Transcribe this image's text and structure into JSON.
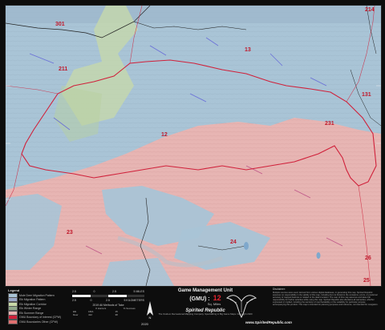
{
  "map": {
    "gmu_labels": [
      {
        "id": "gmu-301",
        "text": "301"
      },
      {
        "id": "gmu-211",
        "text": "211"
      },
      {
        "id": "gmu-13",
        "text": "13"
      },
      {
        "id": "gmu-131",
        "text": "131"
      },
      {
        "id": "gmu-12",
        "text": "12"
      },
      {
        "id": "gmu-231",
        "text": "231"
      },
      {
        "id": "gmu-23",
        "text": "23"
      },
      {
        "id": "gmu-24",
        "text": "24"
      },
      {
        "id": "gmu-26",
        "text": "26"
      },
      {
        "id": "gmu-25",
        "text": "25"
      },
      {
        "id": "gmu-214",
        "text": "214"
      }
    ],
    "colors": {
      "water_blue": "#a9c4d6",
      "elk_pink": "#e7b5b3",
      "green_corridor": "#c8d9a8",
      "boundary_red": "#d0203a",
      "road_black": "#222222"
    }
  },
  "legend": {
    "title": "Legend",
    "items": [
      {
        "label": "Mule Deer Migration Pattern",
        "color": "#a9c4d6"
      },
      {
        "label": "Elk Migration Pattern",
        "color": "#9aa8c9"
      },
      {
        "label": "Elk Migration Corridor",
        "color": "#c8d9a8"
      },
      {
        "label": "Elk Winter Range",
        "color": "#8fa88a"
      },
      {
        "label": "Elk Summer Range",
        "color": "#e7b5b3"
      },
      {
        "label": "GMU Boundary of Interest (CPW)",
        "color": "#d0203a"
      },
      {
        "label": "GMU Boundaries Other (CPW)",
        "color": "#e07070"
      }
    ]
  },
  "scale": {
    "labels_top": [
      "2.5",
      "0",
      "2.5",
      "5 MILES"
    ],
    "labels_bottom": [
      "2.5",
      "0",
      "2.5",
      "5 KILOMETERS"
    ]
  },
  "stats": {
    "title": "2019 All Methods of Take",
    "headers": [
      "",
      "# Hunters",
      "% Success"
    ],
    "rows": [
      {
        "species": "Elk",
        "hunters": "1821",
        "success": "15"
      },
      {
        "species": "Deer",
        "hunters": "412",
        "success": "38"
      }
    ]
  },
  "title_block": {
    "title": "Game Management Unit",
    "gmu_prefix": "(GMU) :",
    "gmu_value": "12",
    "sq_miles": "Sq. Miles",
    "brand": "Spirited Republic",
    "brand_sub": "The Outdoor Recreational Mapping Company. Specializing in Big Game Maps. Copyright 2020",
    "year": "2020",
    "url": "www.SpiritedRepublic.com"
  },
  "disclaimer": {
    "title": "Disclaimer:",
    "body": "Multiple sources were used, derived from various digital databases, in generating this map. Spirited Republic assumes no responsibility in the validity of this map, including but not limited to the omissions, errors, or positional accuracy of mapped features or related to the data's location. The user of this map assumes and takes full responsibility for his/her activities while using this map. Spirited Republic also disclaims all warranties, whether expressed or implied, including the warranty of merchantability or the suitability for particular purpose accompanying this product. This map is intended for planning purposes and reference, not intended for navigation."
  }
}
